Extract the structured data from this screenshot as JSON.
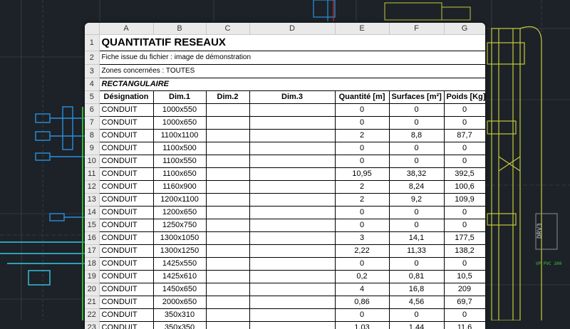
{
  "background": {
    "labels": [
      "DRV3",
      "VP PVC 100"
    ],
    "colors": {
      "bg": "#1c2227",
      "yellow": "#c8c83a",
      "blue": "#2a8fe0",
      "cyan": "#38c8e8",
      "green": "#3ec83e"
    }
  },
  "sheet": {
    "columns": [
      "A",
      "B",
      "C",
      "D",
      "E",
      "F",
      "G"
    ],
    "title": "QUANTITATIF RESEAUX",
    "info1": "Fiche issue du fichier : image de démonstration",
    "info2": "Zones concernées : TOUTES",
    "section": "RECTANGULAIRE",
    "headers": [
      "Désignation",
      "Dim.1",
      "Dim.2",
      "Dim.3",
      "Quantité [m]",
      "Surfaces [m²]",
      "Poids [Kg]"
    ],
    "row_numbers": [
      "1",
      "2",
      "3",
      "4",
      "5"
    ],
    "rows": [
      {
        "n": "6",
        "des": "CONDUIT",
        "dim1": "1000x550",
        "dim2": "",
        "dim3": "",
        "qty": "0",
        "surf": "0",
        "poids": "0"
      },
      {
        "n": "7",
        "des": "CONDUIT",
        "dim1": "1000x650",
        "dim2": "",
        "dim3": "",
        "qty": "0",
        "surf": "0",
        "poids": "0"
      },
      {
        "n": "8",
        "des": "CONDUIT",
        "dim1": "1100x1100",
        "dim2": "",
        "dim3": "",
        "qty": "2",
        "surf": "8,8",
        "poids": "87,7"
      },
      {
        "n": "9",
        "des": "CONDUIT",
        "dim1": "1100x500",
        "dim2": "",
        "dim3": "",
        "qty": "0",
        "surf": "0",
        "poids": "0"
      },
      {
        "n": "10",
        "des": "CONDUIT",
        "dim1": "1100x550",
        "dim2": "",
        "dim3": "",
        "qty": "0",
        "surf": "0",
        "poids": "0"
      },
      {
        "n": "11",
        "des": "CONDUIT",
        "dim1": "1100x650",
        "dim2": "",
        "dim3": "",
        "qty": "10,95",
        "surf": "38,32",
        "poids": "392,5"
      },
      {
        "n": "12",
        "des": "CONDUIT",
        "dim1": "1160x900",
        "dim2": "",
        "dim3": "",
        "qty": "2",
        "surf": "8,24",
        "poids": "100,6"
      },
      {
        "n": "13",
        "des": "CONDUIT",
        "dim1": "1200x1100",
        "dim2": "",
        "dim3": "",
        "qty": "2",
        "surf": "9,2",
        "poids": "109,9"
      },
      {
        "n": "14",
        "des": "CONDUIT",
        "dim1": "1200x650",
        "dim2": "",
        "dim3": "",
        "qty": "0",
        "surf": "0",
        "poids": "0"
      },
      {
        "n": "15",
        "des": "CONDUIT",
        "dim1": "1250x750",
        "dim2": "",
        "dim3": "",
        "qty": "0",
        "surf": "0",
        "poids": "0"
      },
      {
        "n": "16",
        "des": "CONDUIT",
        "dim1": "1300x1050",
        "dim2": "",
        "dim3": "",
        "qty": "3",
        "surf": "14,1",
        "poids": "177,5"
      },
      {
        "n": "17",
        "des": "CONDUIT",
        "dim1": "1300x1250",
        "dim2": "",
        "dim3": "",
        "qty": "2,22",
        "surf": "11,33",
        "poids": "138,2"
      },
      {
        "n": "18",
        "des": "CONDUIT",
        "dim1": "1425x550",
        "dim2": "",
        "dim3": "",
        "qty": "0",
        "surf": "0",
        "poids": "0"
      },
      {
        "n": "19",
        "des": "CONDUIT",
        "dim1": "1425x610",
        "dim2": "",
        "dim3": "",
        "qty": "0,2",
        "surf": "0,81",
        "poids": "10,5"
      },
      {
        "n": "20",
        "des": "CONDUIT",
        "dim1": "1450x650",
        "dim2": "",
        "dim3": "",
        "qty": "4",
        "surf": "16,8",
        "poids": "209"
      },
      {
        "n": "21",
        "des": "CONDUIT",
        "dim1": "2000x650",
        "dim2": "",
        "dim3": "",
        "qty": "0,86",
        "surf": "4,56",
        "poids": "69,7"
      },
      {
        "n": "22",
        "des": "CONDUIT",
        "dim1": "350x310",
        "dim2": "",
        "dim3": "",
        "qty": "0",
        "surf": "0",
        "poids": "0"
      },
      {
        "n": "23",
        "des": "CONDUIT",
        "dim1": "350x350",
        "dim2": "",
        "dim3": "",
        "qty": "1,03",
        "surf": "1,44",
        "poids": "11,6"
      }
    ]
  }
}
